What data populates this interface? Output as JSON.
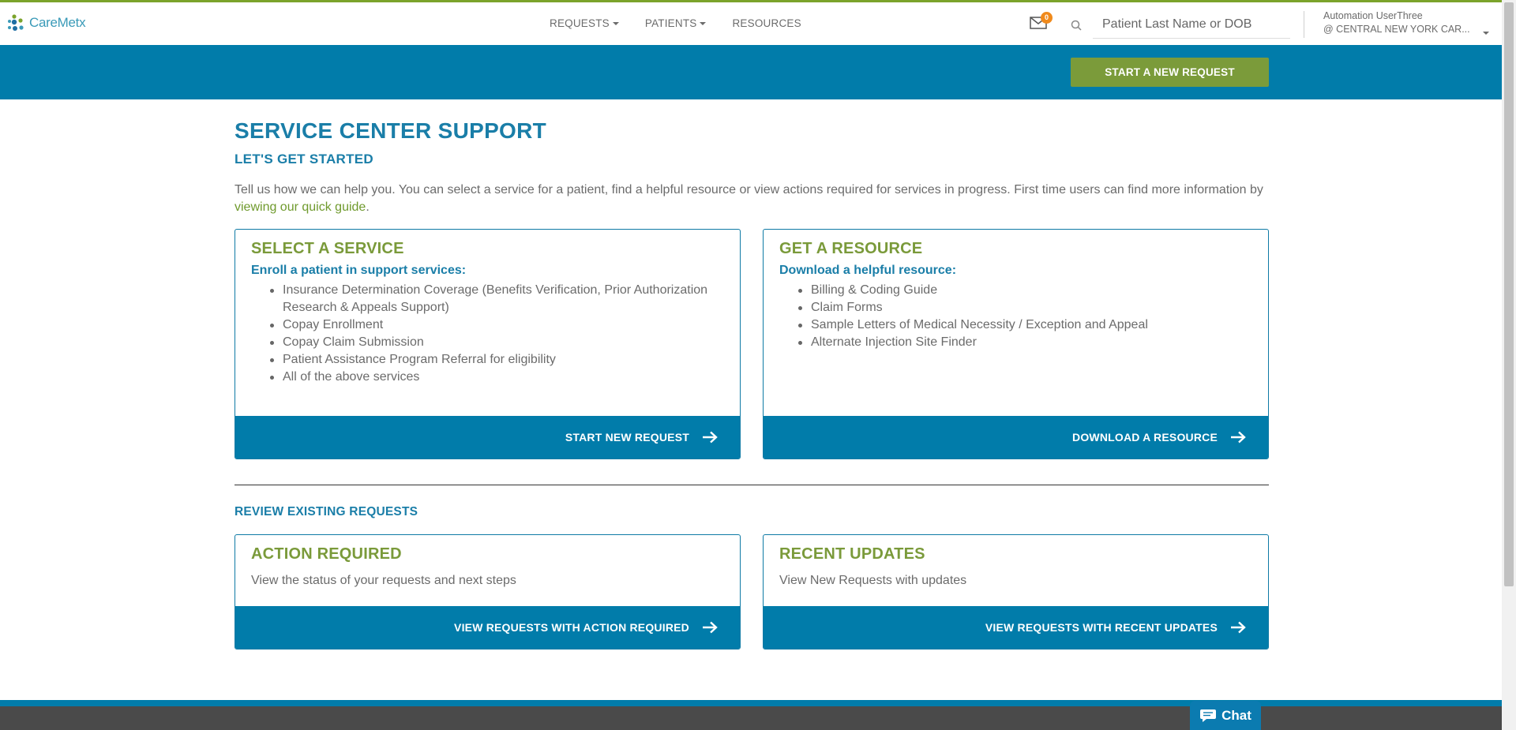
{
  "app": {
    "logo_text": "CareMetx"
  },
  "nav": {
    "items": [
      {
        "label": "REQUESTS"
      },
      {
        "label": "PATIENTS"
      },
      {
        "label": "RESOURCES"
      }
    ]
  },
  "header": {
    "notification_count": "0",
    "search_placeholder": "Patient Last Name or DOB",
    "user_name": "Automation UserThree",
    "user_org": "@ CENTRAL NEW YORK CAR..."
  },
  "band": {
    "new_request_label": "START A NEW REQUEST"
  },
  "page": {
    "title": "SERVICE CENTER SUPPORT",
    "subtitle": "LET'S GET STARTED",
    "intro_text": "Tell us how we can help you. You can select a service for a patient, find a helpful resource or view actions required for services in progress. First time users can find more information by ",
    "intro_link": "viewing our quick guide",
    "intro_end": "."
  },
  "cards": {
    "service": {
      "title": "SELECT A SERVICE",
      "subtitle": "Enroll a patient in support services:",
      "items": [
        "Insurance Determination Coverage (Benefits Verification, Prior Authorization Research & Appeals Support)",
        "Copay Enrollment",
        "Copay Claim Submission",
        "Patient Assistance Program Referral for eligibility",
        "All of the above services"
      ],
      "action": "START NEW REQUEST"
    },
    "resource": {
      "title": "GET A RESOURCE",
      "subtitle": "Download a helpful resource:",
      "items": [
        "Billing & Coding Guide",
        "Claim Forms",
        "Sample Letters of Medical Necessity / Exception and Appeal",
        "Alternate Injection Site Finder"
      ],
      "action": "DOWNLOAD A RESOURCE"
    },
    "review_title": "REVIEW EXISTING REQUESTS",
    "action_required": {
      "title": "ACTION REQUIRED",
      "text": "View the status of your requests and next steps",
      "action": "VIEW REQUESTS WITH ACTION REQUIRED"
    },
    "recent_updates": {
      "title": "RECENT UPDATES",
      "text": "View New Requests with updates",
      "action": "VIEW REQUESTS WITH RECENT UPDATES"
    }
  },
  "chat": {
    "label": "Chat"
  },
  "colors": {
    "brand_blue": "#017caa",
    "brand_green": "#7b9b3a",
    "title_blue": "#1a7ea8",
    "badge_orange": "#f08a1c"
  }
}
